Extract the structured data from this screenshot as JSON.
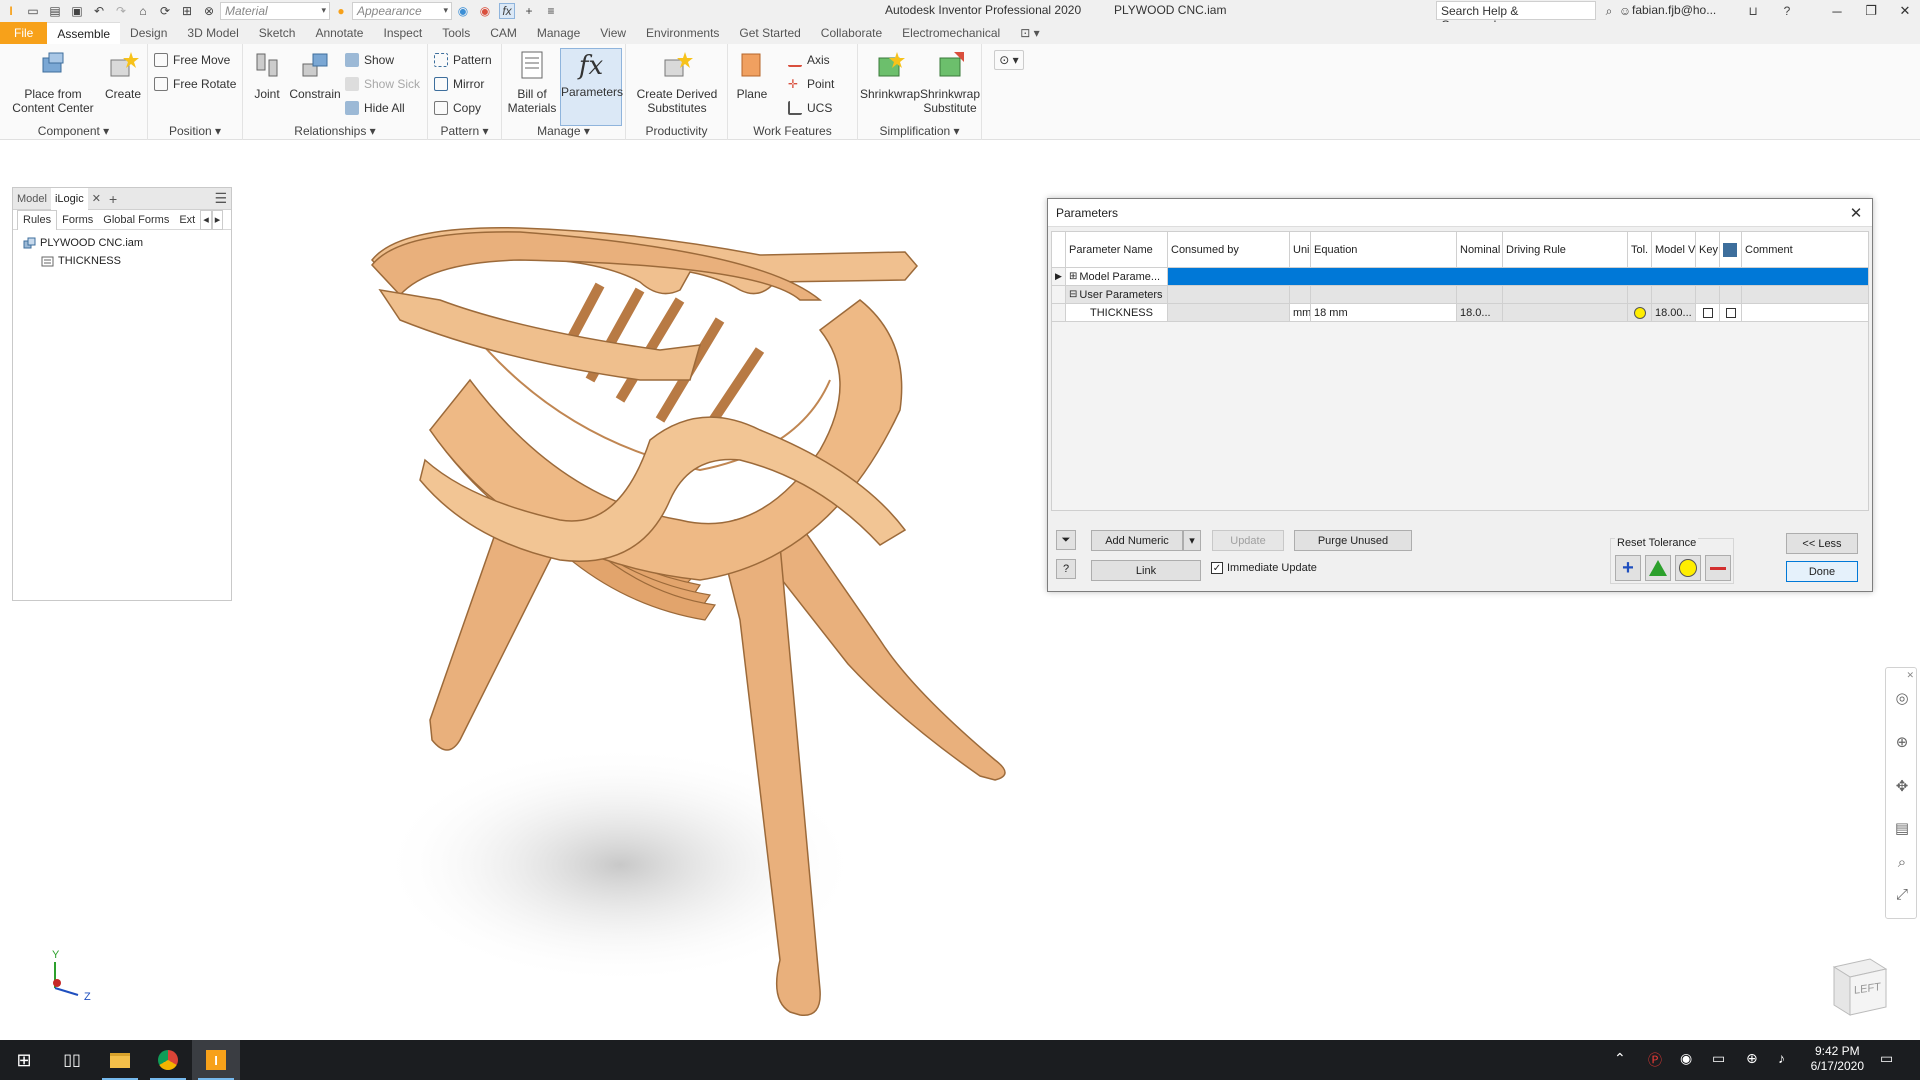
{
  "quick_access": {
    "material_placeholder": "Material",
    "appearance_placeholder": "Appearance"
  },
  "title": {
    "app": "Autodesk Inventor Professional 2020",
    "file": "PLYWOOD CNC.iam",
    "help_search": "Search Help & Commands...",
    "user": "fabian.fjb@ho..."
  },
  "ribbon_tabs": [
    "File",
    "Assemble",
    "Design",
    "3D Model",
    "Sketch",
    "Annotate",
    "Inspect",
    "Tools",
    "CAM",
    "Manage",
    "View",
    "Environments",
    "Get Started",
    "Collaborate",
    "Electromechanical"
  ],
  "ribbon": {
    "component": {
      "label": "Component",
      "place": "Place from\nContent Center",
      "create": "Create"
    },
    "position": {
      "label": "Position",
      "free_move": "Free Move",
      "free_rotate": "Free Rotate"
    },
    "relationships": {
      "label": "Relationships",
      "joint": "Joint",
      "constrain": "Constrain",
      "show": "Show",
      "show_sick": "Show Sick",
      "hide_all": "Hide All"
    },
    "pattern": {
      "label": "Pattern",
      "pattern": "Pattern",
      "mirror": "Mirror",
      "copy": "Copy"
    },
    "manage": {
      "label": "Manage",
      "bom": "Bill of\nMaterials",
      "parameters": "Parameters"
    },
    "productivity": {
      "label": "Productivity",
      "derived": "Create Derived\nSubstitutes"
    },
    "work_features": {
      "label": "Work Features",
      "plane": "Plane",
      "axis": "Axis",
      "point": "Point",
      "ucs": "UCS"
    },
    "simplification": {
      "label": "Simplification",
      "shrinkwrap": "Shrinkwrap",
      "shrinkwrap_sub": "Shrinkwrap\nSubstitute"
    }
  },
  "browser": {
    "tabs": [
      "Model",
      "iLogic"
    ],
    "sub_tabs": [
      "Rules",
      "Forms",
      "Global Forms",
      "Ext"
    ],
    "tree": [
      "PLYWOOD CNC.iam",
      "THICKNESS"
    ]
  },
  "parameters_dialog": {
    "title": "Parameters",
    "columns": [
      "Parameter Name",
      "Consumed by",
      "Uni",
      "Equation",
      "Nominal",
      "Driving Rule",
      "Tol.",
      "Model V",
      "Key",
      "",
      "Comment"
    ],
    "rows": [
      {
        "name": "Model Parame...",
        "consumed": "",
        "unit": "",
        "equation": "",
        "nominal": "",
        "rule": "",
        "model": ""
      },
      {
        "name": "User Parameters",
        "consumed": "",
        "unit": "",
        "equation": "",
        "nominal": "",
        "rule": "",
        "model": ""
      },
      {
        "name": "THICKNESS",
        "consumed": "",
        "unit": "mm",
        "equation": "18 mm",
        "nominal": "18.0...",
        "rule": "",
        "model": "18.00..."
      }
    ],
    "buttons": {
      "add_numeric": "Add Numeric",
      "update": "Update",
      "purge": "Purge Unused",
      "link": "Link",
      "immediate_update": "Immediate Update",
      "reset_tolerance": "Reset Tolerance",
      "less": "<< Less",
      "done": "Done"
    },
    "immediate_update_checked": true
  },
  "viewcube_label": "LEFT",
  "taskbar": {
    "time": "9:42 PM",
    "date": "6/17/2020"
  },
  "colors": {
    "file_tab": "#f7a11a",
    "selection": "#0078d7",
    "plywood": "#e9b07c",
    "plywood_edge": "#c48a56"
  }
}
